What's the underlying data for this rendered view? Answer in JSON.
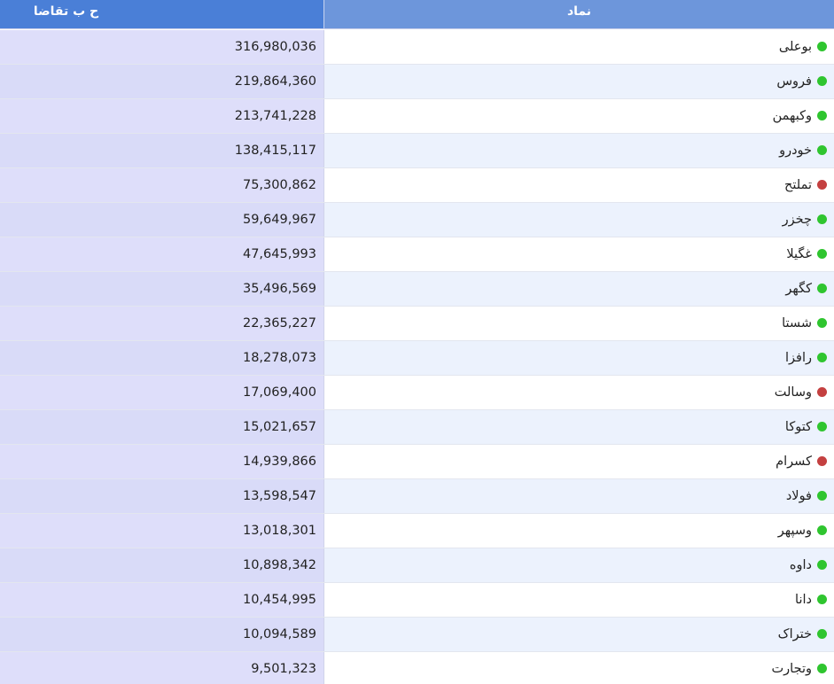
{
  "colors": {
    "header_value_bg": "#4a7fd7",
    "header_symbol_bg": "#6d96db",
    "positive": "#2fc52f",
    "negative": "#c44040"
  },
  "table": {
    "columns": {
      "value": "ح ب تقاضا",
      "symbol": "نماد"
    },
    "rows": [
      {
        "symbol": "بوعلی",
        "value": "316,980,036",
        "status": "green"
      },
      {
        "symbol": "فروس",
        "value": "219,864,360",
        "status": "green"
      },
      {
        "symbol": "وکبهمن",
        "value": "213,741,228",
        "status": "green"
      },
      {
        "symbol": "خودرو",
        "value": "138,415,117",
        "status": "green"
      },
      {
        "symbol": "تملتح",
        "value": "75,300,862",
        "status": "red"
      },
      {
        "symbol": "چخزر",
        "value": "59,649,967",
        "status": "green"
      },
      {
        "symbol": "غگیلا",
        "value": "47,645,993",
        "status": "green"
      },
      {
        "symbol": "کگهر",
        "value": "35,496,569",
        "status": "green"
      },
      {
        "symbol": "شستا",
        "value": "22,365,227",
        "status": "green"
      },
      {
        "symbol": "رافزا",
        "value": "18,278,073",
        "status": "green"
      },
      {
        "symbol": "وسالت",
        "value": "17,069,400",
        "status": "red"
      },
      {
        "symbol": "کتوکا",
        "value": "15,021,657",
        "status": "green"
      },
      {
        "symbol": "کسرام",
        "value": "14,939,866",
        "status": "red"
      },
      {
        "symbol": "فولاد",
        "value": "13,598,547",
        "status": "green"
      },
      {
        "symbol": "وسپهر",
        "value": "13,018,301",
        "status": "green"
      },
      {
        "symbol": "داوه",
        "value": "10,898,342",
        "status": "green"
      },
      {
        "symbol": "دانا",
        "value": "10,454,995",
        "status": "green"
      },
      {
        "symbol": "ختراک",
        "value": "10,094,589",
        "status": "green"
      },
      {
        "symbol": "وتجارت",
        "value": "9,501,323",
        "status": "green"
      }
    ]
  }
}
